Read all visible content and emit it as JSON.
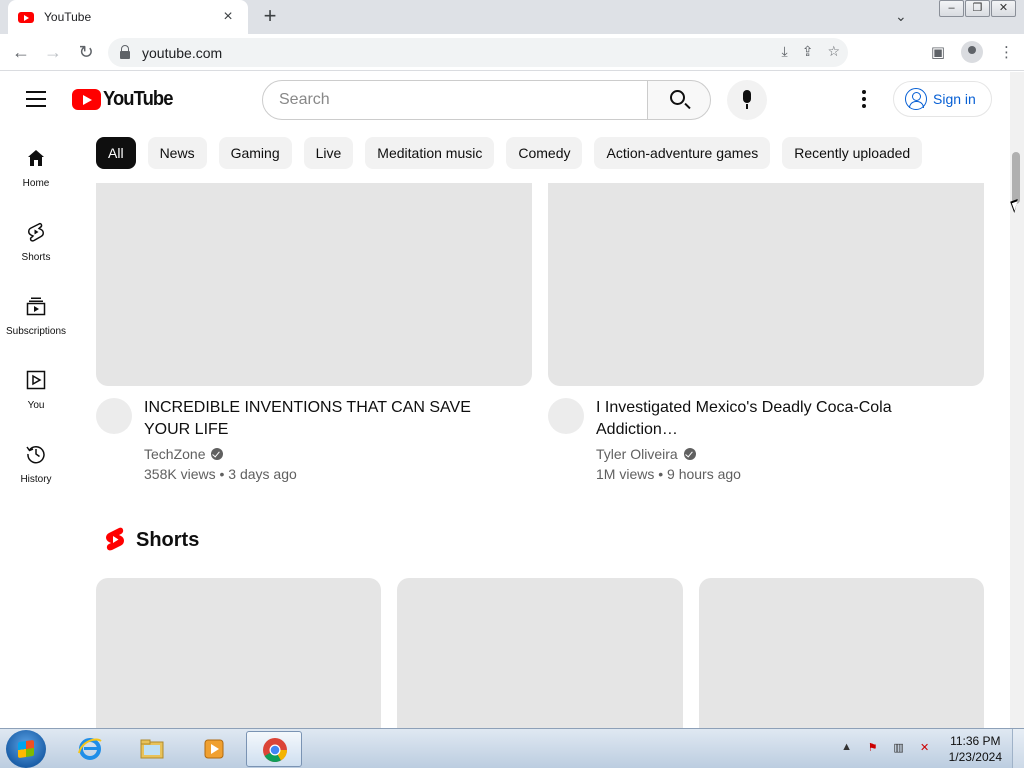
{
  "browser": {
    "tab_title": "YouTube",
    "url": "youtube.com",
    "tab_close": "×",
    "new_tab": "+"
  },
  "header": {
    "logo_text": "YouTube",
    "search_placeholder": "Search",
    "signin_label": "Sign in"
  },
  "chips": [
    "All",
    "News",
    "Gaming",
    "Live",
    "Meditation music",
    "Comedy",
    "Action-adventure games",
    "Recently uploaded"
  ],
  "guide": [
    {
      "label": "Home",
      "icon": "home-icon"
    },
    {
      "label": "Shorts",
      "icon": "shorts-icon"
    },
    {
      "label": "Subscriptions",
      "icon": "subscriptions-icon"
    },
    {
      "label": "You",
      "icon": "you-icon"
    },
    {
      "label": "History",
      "icon": "history-icon"
    }
  ],
  "videos": [
    {
      "title": "INCREDIBLE INVENTIONS THAT CAN SAVE YOUR LIFE",
      "channel": "TechZone",
      "stats": "358K views • 3 days ago"
    },
    {
      "title": "I Investigated Mexico's Deadly Coca-Cola Addiction…",
      "channel": "Tyler Oliveira",
      "stats": "1M views • 9 hours ago"
    }
  ],
  "shorts": {
    "title": "Shorts"
  },
  "taskbar": {
    "time": "11:36 PM",
    "date": "1/23/2024"
  },
  "colors": {
    "brand_red": "#ff0000",
    "link_blue": "#065fd4",
    "placeholder_gray": "#e5e5e5"
  }
}
